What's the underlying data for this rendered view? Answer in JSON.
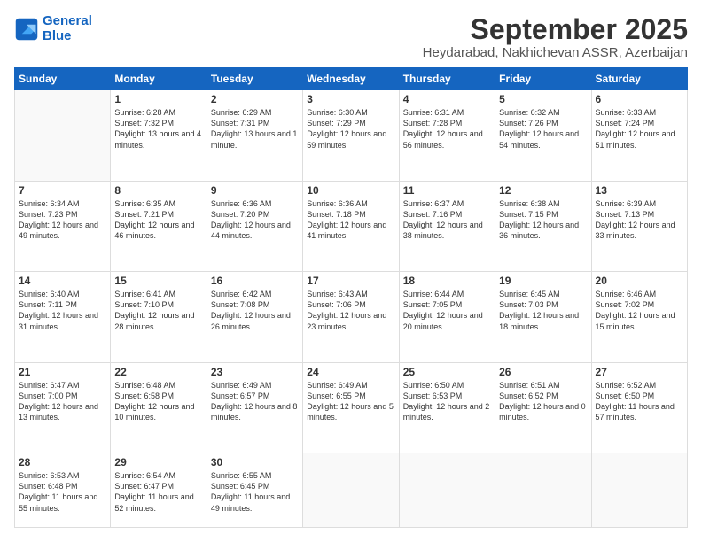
{
  "logo": {
    "line1": "General",
    "line2": "Blue"
  },
  "title": "September 2025",
  "subtitle": "Heydarabad, Nakhichevan ASSR, Azerbaijan",
  "weekdays": [
    "Sunday",
    "Monday",
    "Tuesday",
    "Wednesday",
    "Thursday",
    "Friday",
    "Saturday"
  ],
  "weeks": [
    [
      {
        "day": "",
        "sunrise": "",
        "sunset": "",
        "daylight": ""
      },
      {
        "day": "1",
        "sunrise": "Sunrise: 6:28 AM",
        "sunset": "Sunset: 7:32 PM",
        "daylight": "Daylight: 13 hours and 4 minutes."
      },
      {
        "day": "2",
        "sunrise": "Sunrise: 6:29 AM",
        "sunset": "Sunset: 7:31 PM",
        "daylight": "Daylight: 13 hours and 1 minute."
      },
      {
        "day": "3",
        "sunrise": "Sunrise: 6:30 AM",
        "sunset": "Sunset: 7:29 PM",
        "daylight": "Daylight: 12 hours and 59 minutes."
      },
      {
        "day": "4",
        "sunrise": "Sunrise: 6:31 AM",
        "sunset": "Sunset: 7:28 PM",
        "daylight": "Daylight: 12 hours and 56 minutes."
      },
      {
        "day": "5",
        "sunrise": "Sunrise: 6:32 AM",
        "sunset": "Sunset: 7:26 PM",
        "daylight": "Daylight: 12 hours and 54 minutes."
      },
      {
        "day": "6",
        "sunrise": "Sunrise: 6:33 AM",
        "sunset": "Sunset: 7:24 PM",
        "daylight": "Daylight: 12 hours and 51 minutes."
      }
    ],
    [
      {
        "day": "7",
        "sunrise": "Sunrise: 6:34 AM",
        "sunset": "Sunset: 7:23 PM",
        "daylight": "Daylight: 12 hours and 49 minutes."
      },
      {
        "day": "8",
        "sunrise": "Sunrise: 6:35 AM",
        "sunset": "Sunset: 7:21 PM",
        "daylight": "Daylight: 12 hours and 46 minutes."
      },
      {
        "day": "9",
        "sunrise": "Sunrise: 6:36 AM",
        "sunset": "Sunset: 7:20 PM",
        "daylight": "Daylight: 12 hours and 44 minutes."
      },
      {
        "day": "10",
        "sunrise": "Sunrise: 6:36 AM",
        "sunset": "Sunset: 7:18 PM",
        "daylight": "Daylight: 12 hours and 41 minutes."
      },
      {
        "day": "11",
        "sunrise": "Sunrise: 6:37 AM",
        "sunset": "Sunset: 7:16 PM",
        "daylight": "Daylight: 12 hours and 38 minutes."
      },
      {
        "day": "12",
        "sunrise": "Sunrise: 6:38 AM",
        "sunset": "Sunset: 7:15 PM",
        "daylight": "Daylight: 12 hours and 36 minutes."
      },
      {
        "day": "13",
        "sunrise": "Sunrise: 6:39 AM",
        "sunset": "Sunset: 7:13 PM",
        "daylight": "Daylight: 12 hours and 33 minutes."
      }
    ],
    [
      {
        "day": "14",
        "sunrise": "Sunrise: 6:40 AM",
        "sunset": "Sunset: 7:11 PM",
        "daylight": "Daylight: 12 hours and 31 minutes."
      },
      {
        "day": "15",
        "sunrise": "Sunrise: 6:41 AM",
        "sunset": "Sunset: 7:10 PM",
        "daylight": "Daylight: 12 hours and 28 minutes."
      },
      {
        "day": "16",
        "sunrise": "Sunrise: 6:42 AM",
        "sunset": "Sunset: 7:08 PM",
        "daylight": "Daylight: 12 hours and 26 minutes."
      },
      {
        "day": "17",
        "sunrise": "Sunrise: 6:43 AM",
        "sunset": "Sunset: 7:06 PM",
        "daylight": "Daylight: 12 hours and 23 minutes."
      },
      {
        "day": "18",
        "sunrise": "Sunrise: 6:44 AM",
        "sunset": "Sunset: 7:05 PM",
        "daylight": "Daylight: 12 hours and 20 minutes."
      },
      {
        "day": "19",
        "sunrise": "Sunrise: 6:45 AM",
        "sunset": "Sunset: 7:03 PM",
        "daylight": "Daylight: 12 hours and 18 minutes."
      },
      {
        "day": "20",
        "sunrise": "Sunrise: 6:46 AM",
        "sunset": "Sunset: 7:02 PM",
        "daylight": "Daylight: 12 hours and 15 minutes."
      }
    ],
    [
      {
        "day": "21",
        "sunrise": "Sunrise: 6:47 AM",
        "sunset": "Sunset: 7:00 PM",
        "daylight": "Daylight: 12 hours and 13 minutes."
      },
      {
        "day": "22",
        "sunrise": "Sunrise: 6:48 AM",
        "sunset": "Sunset: 6:58 PM",
        "daylight": "Daylight: 12 hours and 10 minutes."
      },
      {
        "day": "23",
        "sunrise": "Sunrise: 6:49 AM",
        "sunset": "Sunset: 6:57 PM",
        "daylight": "Daylight: 12 hours and 8 minutes."
      },
      {
        "day": "24",
        "sunrise": "Sunrise: 6:49 AM",
        "sunset": "Sunset: 6:55 PM",
        "daylight": "Daylight: 12 hours and 5 minutes."
      },
      {
        "day": "25",
        "sunrise": "Sunrise: 6:50 AM",
        "sunset": "Sunset: 6:53 PM",
        "daylight": "Daylight: 12 hours and 2 minutes."
      },
      {
        "day": "26",
        "sunrise": "Sunrise: 6:51 AM",
        "sunset": "Sunset: 6:52 PM",
        "daylight": "Daylight: 12 hours and 0 minutes."
      },
      {
        "day": "27",
        "sunrise": "Sunrise: 6:52 AM",
        "sunset": "Sunset: 6:50 PM",
        "daylight": "Daylight: 11 hours and 57 minutes."
      }
    ],
    [
      {
        "day": "28",
        "sunrise": "Sunrise: 6:53 AM",
        "sunset": "Sunset: 6:48 PM",
        "daylight": "Daylight: 11 hours and 55 minutes."
      },
      {
        "day": "29",
        "sunrise": "Sunrise: 6:54 AM",
        "sunset": "Sunset: 6:47 PM",
        "daylight": "Daylight: 11 hours and 52 minutes."
      },
      {
        "day": "30",
        "sunrise": "Sunrise: 6:55 AM",
        "sunset": "Sunset: 6:45 PM",
        "daylight": "Daylight: 11 hours and 49 minutes."
      },
      {
        "day": "",
        "sunrise": "",
        "sunset": "",
        "daylight": ""
      },
      {
        "day": "",
        "sunrise": "",
        "sunset": "",
        "daylight": ""
      },
      {
        "day": "",
        "sunrise": "",
        "sunset": "",
        "daylight": ""
      },
      {
        "day": "",
        "sunrise": "",
        "sunset": "",
        "daylight": ""
      }
    ]
  ]
}
